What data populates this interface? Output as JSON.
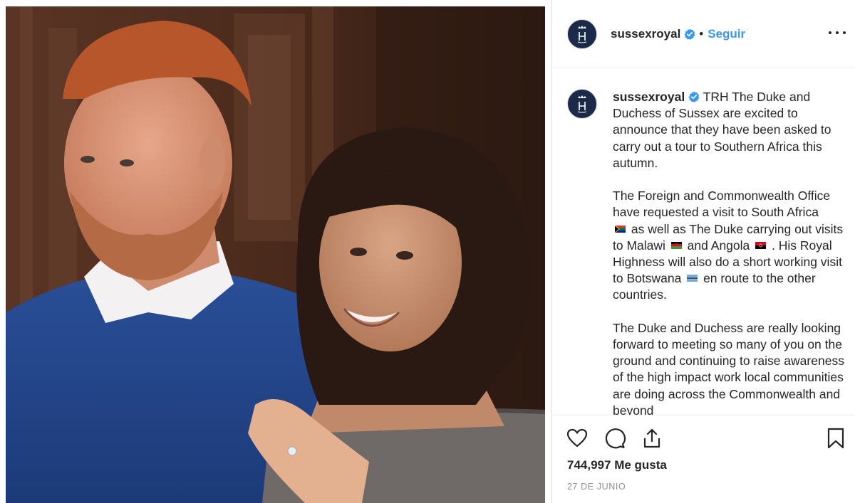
{
  "post": {
    "username": "sussexroyal",
    "follow_label": "Seguir",
    "separator": "•",
    "more_options_icon": "more-horizontal-icon",
    "photo_alt": "Photo of the Duke and Duchess of Sussex"
  },
  "caption": {
    "username": "sussexroyal",
    "paragraph1": "TRH The Duke and Duchess of Sussex are excited to announce that they have been asked to carry out a tour to Southern Africa this autumn.",
    "p2_part1": "The Foreign and Commonwealth Office have requested a visit to South Africa",
    "p2_part2": "as well as The Duke carrying out visits to Malawi",
    "p2_part3": "and Angola",
    "p2_part4": ". His Royal Highness will also do a short working visit to Botswana",
    "p2_part5": "en route to the other countries.",
    "paragraph3": "The Duke and Duchess are really looking forward to meeting so many of you on the ground and continuing to raise awareness of the high impact work local communities are doing across the Commonwealth and beyond"
  },
  "actions": {
    "like_icon": "heart-icon",
    "comment_icon": "comment-icon",
    "share_icon": "share-icon",
    "save_icon": "bookmark-icon",
    "likes_count": "744,997",
    "likes_suffix": "Me gusta",
    "date": "27 DE JUNIO"
  },
  "colors": {
    "link": "#3897f0",
    "text": "#262626",
    "muted": "#8e8e8e",
    "verified": "#3897f0",
    "avatar_bg": "#1c2a4a"
  }
}
